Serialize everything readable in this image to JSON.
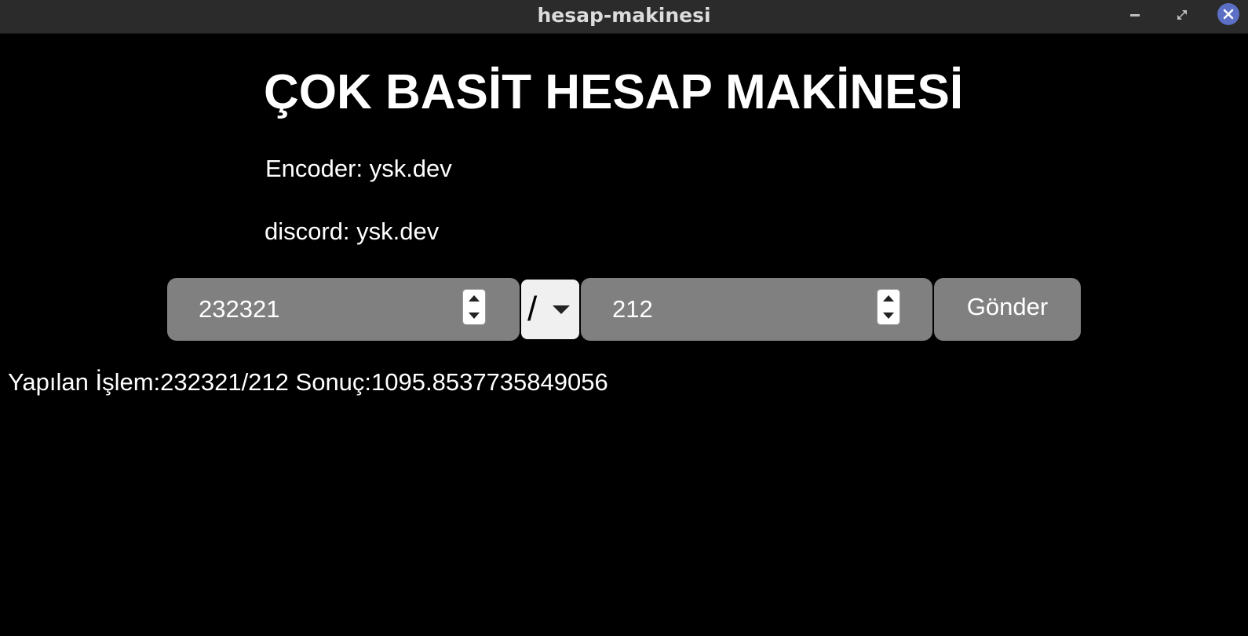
{
  "window": {
    "title": "hesap-makinesi",
    "controls": {
      "minimize_icon": "minimize-icon",
      "maximize_icon": "maximize-icon",
      "close_icon": "close-icon",
      "close_color": "#5b6fc4"
    }
  },
  "page": {
    "heading": "ÇOK BASİT HESAP MAKİNESİ",
    "encoder": "Encoder: ysk.dev",
    "discord": "discord: ysk.dev"
  },
  "form": {
    "number1_value": "232321",
    "operator_value": "/",
    "number2_value": "212",
    "submit_label": "Gönder"
  },
  "result": {
    "text": "Yapılan İşlem:232321/212 Sonuç:1095.8537735849056"
  },
  "colors": {
    "background": "#000000",
    "titlebar": "#2b2b2b",
    "field": "#808080",
    "operator_bg": "#f0f0f0",
    "text": "#ffffff"
  }
}
